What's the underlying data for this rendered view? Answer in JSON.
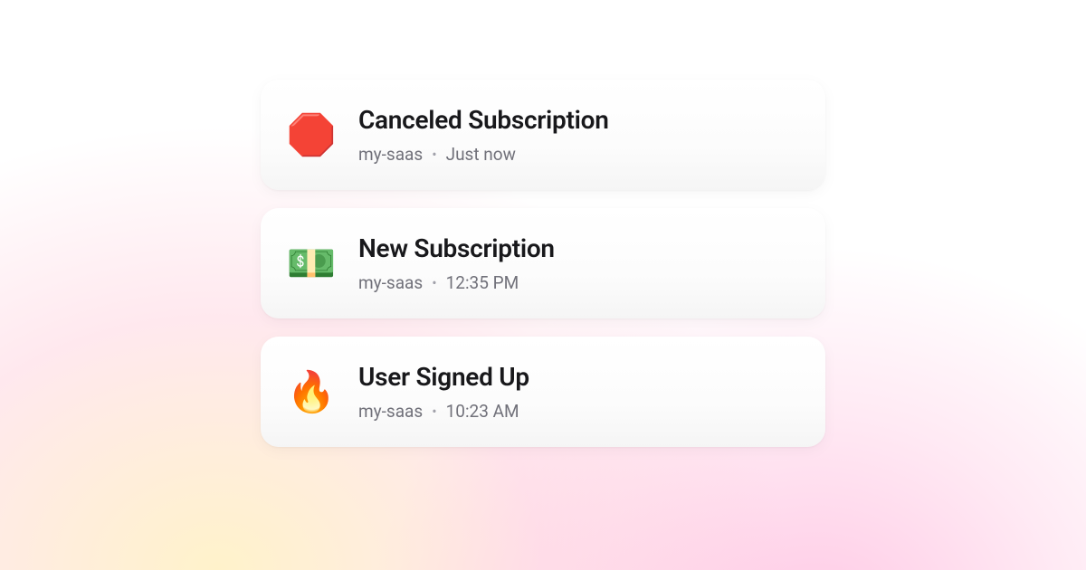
{
  "notifications": [
    {
      "icon": "🛑",
      "icon_name": "stop-sign-icon",
      "title": "Canceled Subscription",
      "project": "my-saas",
      "time": "Just now"
    },
    {
      "icon": "💵",
      "icon_name": "money-icon",
      "title": "New Subscription",
      "project": "my-saas",
      "time": "12:35 PM"
    },
    {
      "icon": "🔥",
      "icon_name": "fire-icon",
      "title": "User Signed Up",
      "project": "my-saas",
      "time": "10:23 AM"
    }
  ],
  "separator": "•"
}
